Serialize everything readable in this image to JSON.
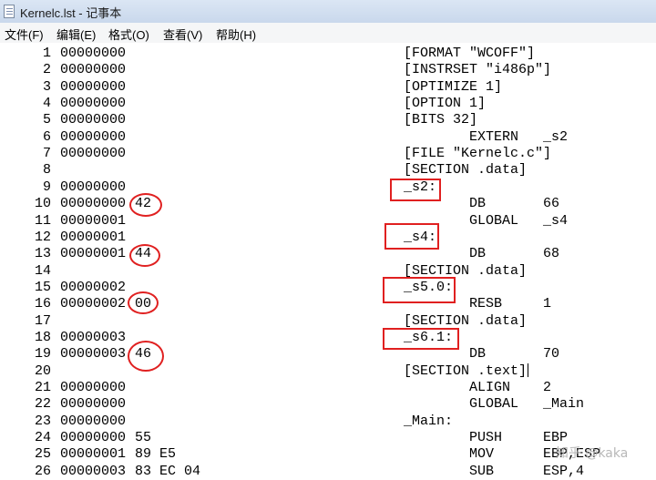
{
  "window": {
    "title": "Kernelc.lst - 记事本"
  },
  "menu": [
    "文件(F)",
    "编辑(E)",
    "格式(O)",
    "查看(V)",
    "帮助(H)"
  ],
  "lines": [
    {
      "n": "1",
      "addr": "00000000",
      "bytes": "",
      "src": "[FORMAT \"WCOFF\"]",
      "indent": false
    },
    {
      "n": "2",
      "addr": "00000000",
      "bytes": "",
      "src": "[INSTRSET \"i486p\"]",
      "indent": false
    },
    {
      "n": "3",
      "addr": "00000000",
      "bytes": "",
      "src": "[OPTIMIZE 1]",
      "indent": false
    },
    {
      "n": "4",
      "addr": "00000000",
      "bytes": "",
      "src": "[OPTION 1]",
      "indent": false
    },
    {
      "n": "5",
      "addr": "00000000",
      "bytes": "",
      "src": "[BITS 32]",
      "indent": false
    },
    {
      "n": "6",
      "addr": "00000000",
      "bytes": "",
      "src": "EXTERN   _s2",
      "indent": true
    },
    {
      "n": "7",
      "addr": "00000000",
      "bytes": "",
      "src": "[FILE \"Kernelc.c\"]",
      "indent": false
    },
    {
      "n": "8",
      "addr": "",
      "bytes": "",
      "src": "[SECTION .data]",
      "indent": false
    },
    {
      "n": "9",
      "addr": "00000000",
      "bytes": "",
      "src": "_s2:",
      "indent": false
    },
    {
      "n": "10",
      "addr": "00000000",
      "bytes": "42",
      "src": "DB       66",
      "indent": true
    },
    {
      "n": "11",
      "addr": "00000001",
      "bytes": "",
      "src": "GLOBAL   _s4",
      "indent": true
    },
    {
      "n": "12",
      "addr": "00000001",
      "bytes": "",
      "src": "_s4:",
      "indent": false
    },
    {
      "n": "13",
      "addr": "00000001",
      "bytes": "44",
      "src": "DB       68",
      "indent": true
    },
    {
      "n": "14",
      "addr": "",
      "bytes": "",
      "src": "[SECTION .data]",
      "indent": false
    },
    {
      "n": "15",
      "addr": "00000002",
      "bytes": "",
      "src": "_s5.0:",
      "indent": false
    },
    {
      "n": "16",
      "addr": "00000002",
      "bytes": "00",
      "src": "RESB     1",
      "indent": true
    },
    {
      "n": "17",
      "addr": "",
      "bytes": "",
      "src": "[SECTION .data]",
      "indent": false
    },
    {
      "n": "18",
      "addr": "00000003",
      "bytes": "",
      "src": "_s6.1:",
      "indent": false
    },
    {
      "n": "19",
      "addr": "00000003",
      "bytes": "46",
      "src": "DB       70",
      "indent": true
    },
    {
      "n": "20",
      "addr": "",
      "bytes": "",
      "src": "[SECTION .text]",
      "indent": false
    },
    {
      "n": "21",
      "addr": "00000000",
      "bytes": "",
      "src": "ALIGN    2",
      "indent": true
    },
    {
      "n": "22",
      "addr": "00000000",
      "bytes": "",
      "src": "GLOBAL   _Main",
      "indent": true
    },
    {
      "n": "23",
      "addr": "00000000",
      "bytes": "",
      "src": "_Main:",
      "indent": false
    },
    {
      "n": "24",
      "addr": "00000000",
      "bytes": "55",
      "src": "PUSH     EBP",
      "indent": true
    },
    {
      "n": "25",
      "addr": "00000001",
      "bytes": "89 E5",
      "src": "MOV      EBP,ESP",
      "indent": true
    },
    {
      "n": "26",
      "addr": "00000003",
      "bytes": "83 EC 04",
      "src": "SUB      ESP,4",
      "indent": true
    }
  ],
  "watermark": "知乎 @kaka",
  "colors": {
    "annotation": "#e02020",
    "titlebar": "#c9d8ec"
  }
}
